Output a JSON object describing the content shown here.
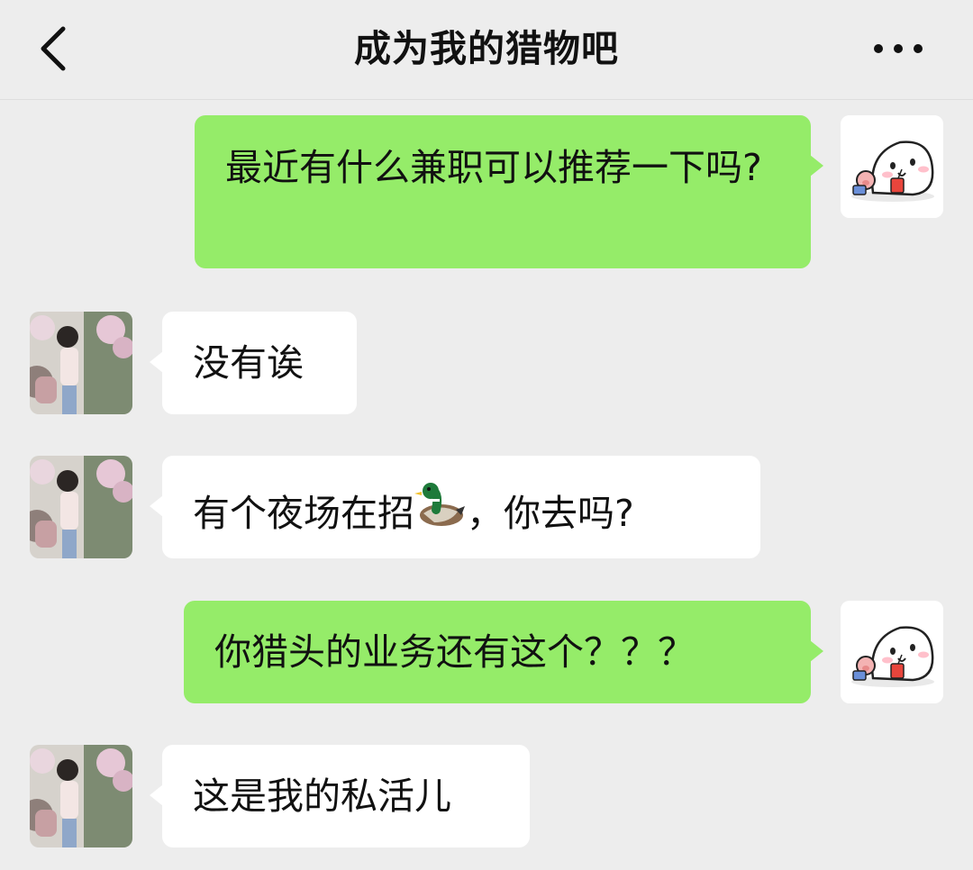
{
  "header": {
    "title": "成为我的猎物吧",
    "back_icon": "chevron-left-icon",
    "more_icon": "ellipsis-icon"
  },
  "colors": {
    "background": "#EDEDED",
    "outgoing_bubble": "#95EC69",
    "incoming_bubble": "#FFFFFF",
    "text": "#111111"
  },
  "messages": [
    {
      "sender": "me",
      "text": "最近有什么兼职可以推荐一下吗?"
    },
    {
      "sender": "other",
      "text": "没有诶"
    },
    {
      "sender": "other",
      "text_before": "有个夜场在招",
      "emoji": "duck-emoji",
      "text_after": "，你去吗?"
    },
    {
      "sender": "me",
      "text": "你猎头的业务还有这个？？？"
    },
    {
      "sender": "other",
      "text": "这是我的私活儿"
    }
  ]
}
